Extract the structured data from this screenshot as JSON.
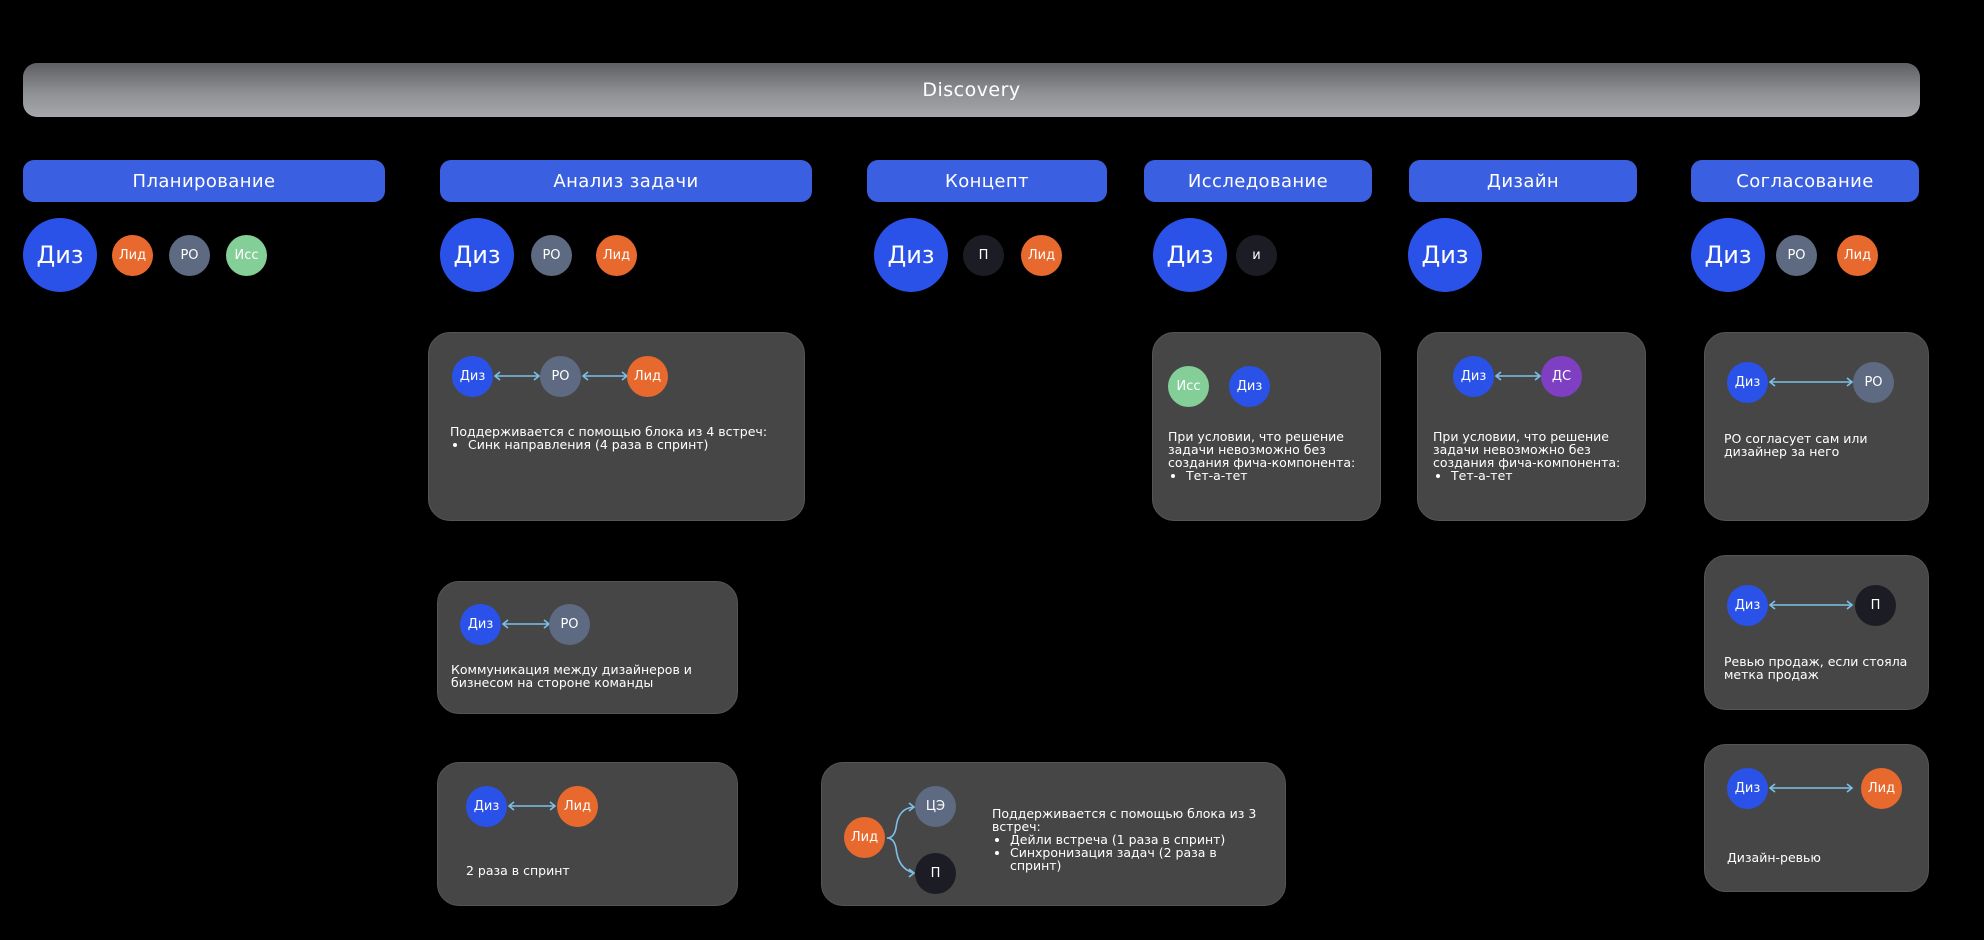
{
  "banner": "Discovery",
  "phases": [
    "Планирование",
    "Анализ задачи",
    "Концепт",
    "Исследование",
    "Дизайн",
    "Согласование"
  ],
  "roles": {
    "diz": "Диз",
    "lid": "Лид",
    "po": "PO",
    "iss": "Исс",
    "p_cyr": "П",
    "i_lower": "и",
    "ds": "ДС",
    "ce": "ЦЭ"
  },
  "cards": {
    "analysis1": {
      "intro": "Поддерживается с помощью блока из 4 встреч:",
      "items": [
        "Синк направления (4 раза в спринт)"
      ]
    },
    "analysis2": {
      "text": "Коммуникация между дизайнеров и бизнесом на стороне команды"
    },
    "analysis3": {
      "text": "2 раза в спринт"
    },
    "concept": {
      "intro": "Поддерживается с помощью блока из 3 встреч:",
      "items": [
        "Дейли встреча (1 раза в спринт)",
        "Синхронизация задач (2 раза в спринт)"
      ]
    },
    "research": {
      "intro": "При условии, что решение задачи невозможно без создания фича-компонента:",
      "items": [
        "Тет-а-тет"
      ]
    },
    "design": {
      "intro": "При условии, что решение задачи невозможно без создания фича-компонента:",
      "items": [
        "Тет-а-тет"
      ]
    },
    "approval1": {
      "text": "PO согласует сам или дизайнер за него"
    },
    "approval2": {
      "text": "Ревью продаж, если стояла метка продаж"
    },
    "approval3": {
      "text": "Дизайн-ревью"
    }
  },
  "colors": {
    "phase": "#3a5fe0",
    "designer": "#2a52e8",
    "lead": "#e8692e",
    "po": "#5d6a82",
    "researcher": "#84cf98",
    "dark": "#1c1d24",
    "ds": "#7f3fc2",
    "card": "#464646",
    "arrow": "#7cc0e8"
  }
}
